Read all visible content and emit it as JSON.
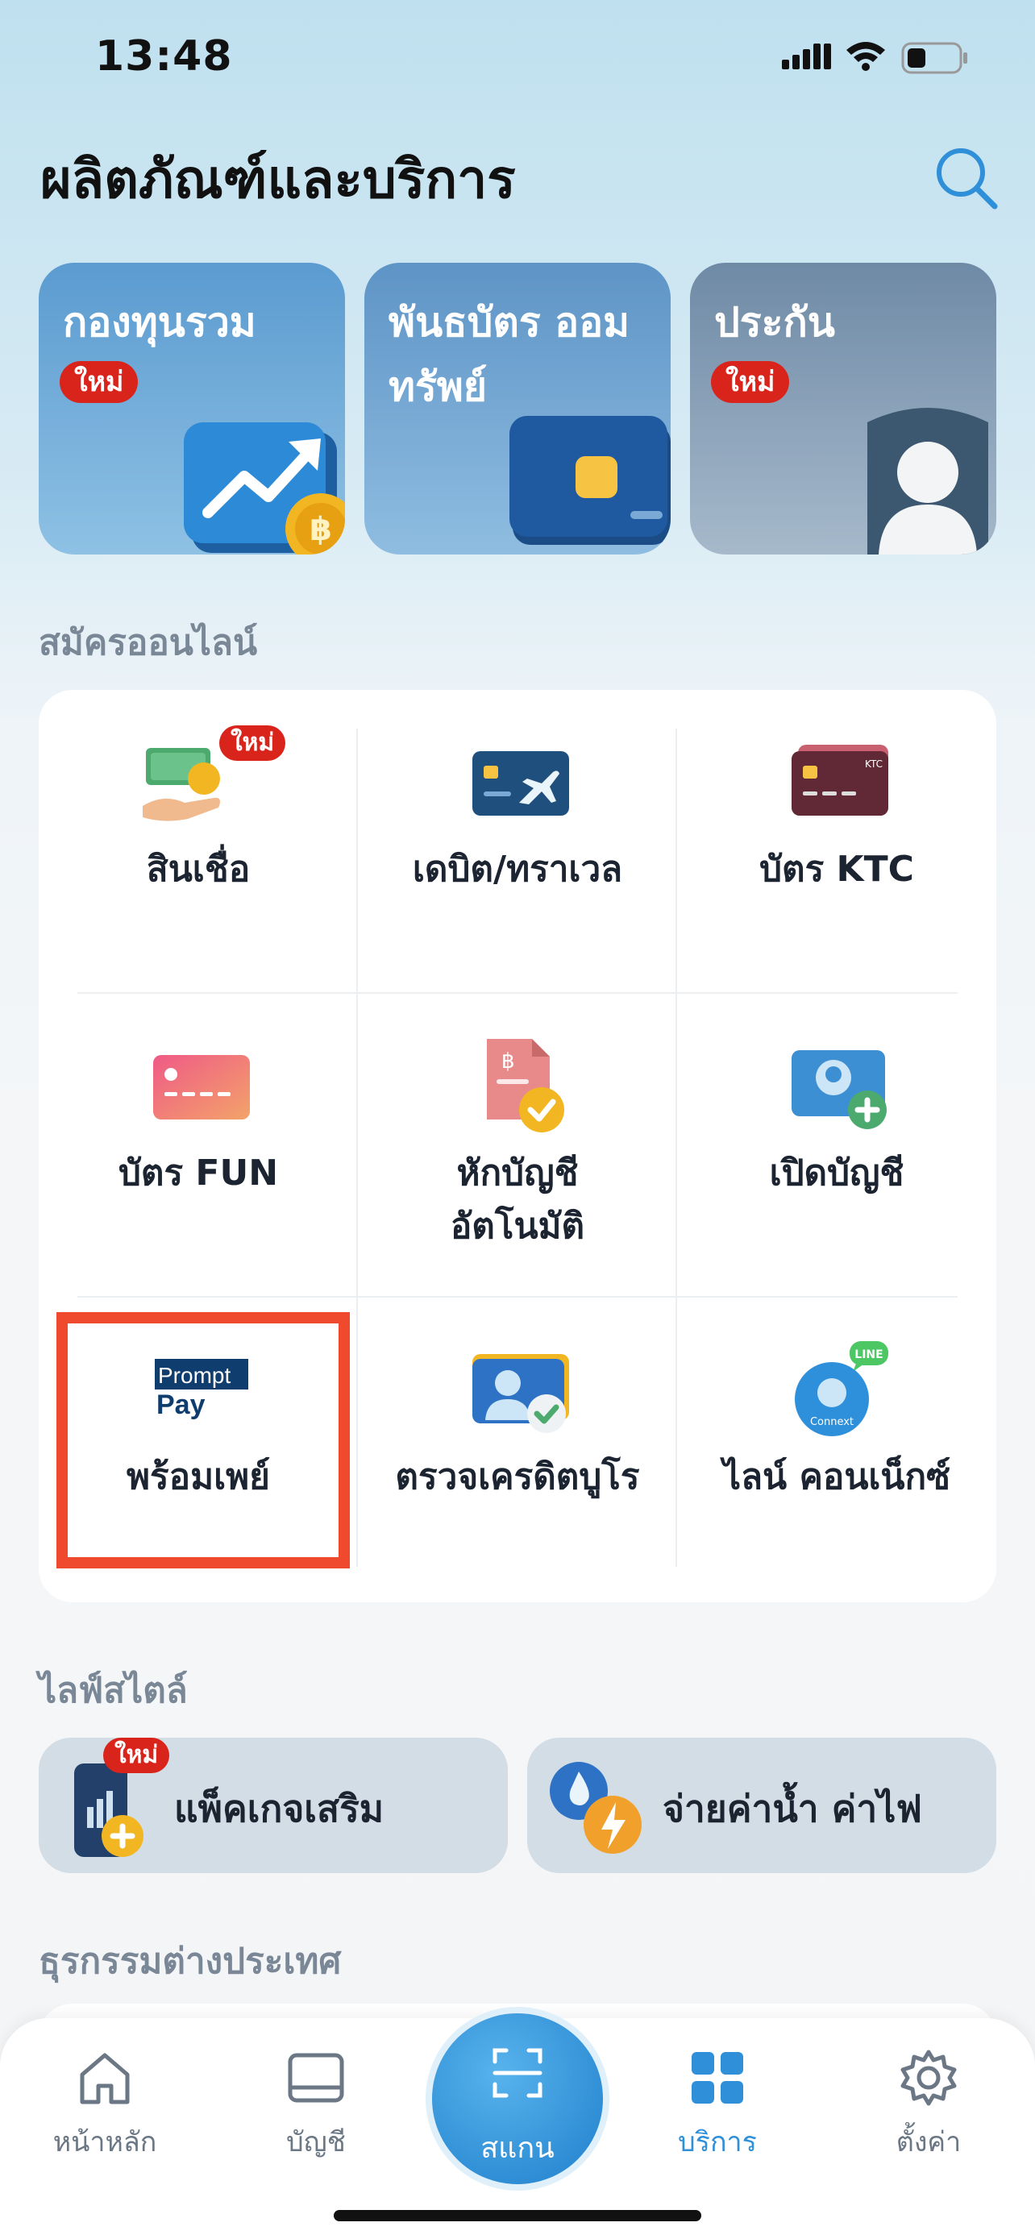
{
  "status_bar": {
    "time": "13:48"
  },
  "header": {
    "title": "ผลิตภัณฑ์และบริการ"
  },
  "hero_cards": [
    {
      "title": "กองทุนรวม",
      "badge": "ใหม่"
    },
    {
      "title": "พันธบัตร ออมทรัพย์",
      "badge": ""
    },
    {
      "title": "ประกัน",
      "badge": "ใหม่"
    }
  ],
  "sections": {
    "online_signup": "สมัครออนไลน์",
    "lifestyle": "ไลฟ์สไตล์",
    "international": "ธุรกรรมต่างประเทศ"
  },
  "services": [
    {
      "label": "สินเชื่อ",
      "badge": "ใหม่",
      "icon": "loan-icon"
    },
    {
      "label": "เดบิต/ทราเวล",
      "icon": "debit-travel-card-icon"
    },
    {
      "label": "บัตร KTC",
      "icon": "ktc-card-icon",
      "card_text": "KTC"
    },
    {
      "label": "บัตร FUN",
      "icon": "fun-card-icon"
    },
    {
      "label": "หักบัญชี\nอัตโนมัติ",
      "icon": "auto-debit-icon"
    },
    {
      "label": "เปิดบัญชี",
      "icon": "open-account-icon"
    },
    {
      "label": "พร้อมเพย์",
      "icon": "promptpay-logo",
      "logo_top": "Prompt",
      "logo_bottom": "Pay"
    },
    {
      "label": "ตรวจเครดิตบูโร",
      "icon": "credit-bureau-icon"
    },
    {
      "label": "ไลน์ คอนเน็กซ์",
      "icon": "line-connext-icon",
      "bubble": "LINE",
      "logo_text": "Connext"
    }
  ],
  "lifestyle": [
    {
      "label": "แพ็คเกจเสริม",
      "badge": "ใหม่",
      "icon": "add-package-icon"
    },
    {
      "label": "จ่ายค่าน้ำ ค่าไฟ",
      "icon": "water-electric-bill-icon"
    }
  ],
  "bottom_nav": [
    {
      "label": "หน้าหลัก",
      "icon": "home-icon",
      "active": false
    },
    {
      "label": "บัญชี",
      "icon": "account-icon",
      "active": false
    },
    {
      "label": "สแกน",
      "icon": "scan-icon",
      "active": false
    },
    {
      "label": "บริการ",
      "icon": "services-grid-icon",
      "active": true
    },
    {
      "label": "ตั้งค่า",
      "icon": "settings-gear-icon",
      "active": false
    }
  ],
  "colors": {
    "accent": "#2f8fd8",
    "badge": "#d9241c",
    "highlight": "#ef4a2e"
  }
}
